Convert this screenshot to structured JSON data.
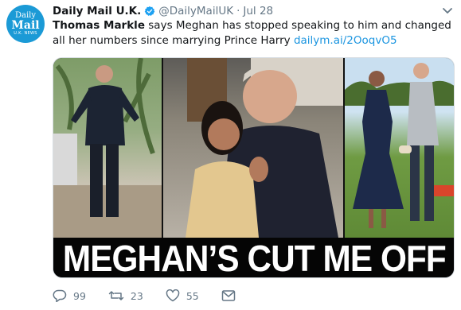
{
  "tweet": {
    "avatar": {
      "line1": "Daily",
      "line2": "Mail",
      "line3": "U.K. NEWS"
    },
    "name": "Daily Mail U.K.",
    "handle": "@DailyMailUK",
    "separator": "·",
    "date": "Jul 28",
    "text_bold": "Thomas Markle",
    "text_rest": " says Meghan has stopped speaking to him and changed all her numbers since marrying Prince Harry ",
    "link": "dailym.ai/2OoqvO5",
    "headline": "MEGHAN’S CUT ME OFF",
    "actions": {
      "replies": "99",
      "retweets": "23",
      "likes": "55"
    }
  },
  "colors": {
    "brand": "#1b9ad6",
    "link": "#1b95e0",
    "muted": "#657786",
    "verified": "#1da1f2"
  },
  "icons": [
    "verified-badge-icon",
    "chevron-down-icon",
    "reply-icon",
    "retweet-icon",
    "like-icon",
    "direct-message-icon"
  ]
}
